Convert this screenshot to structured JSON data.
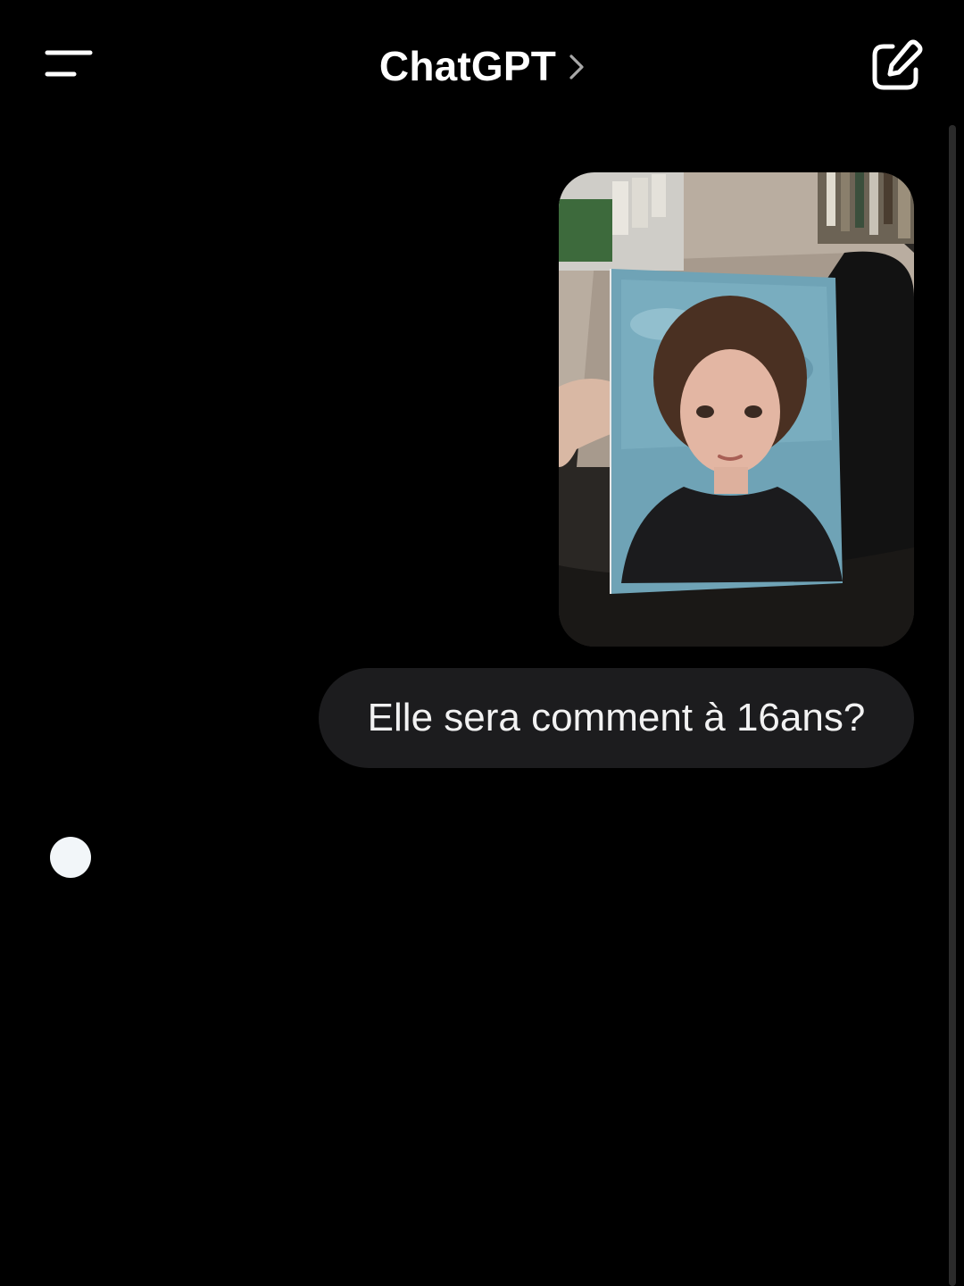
{
  "header": {
    "title": "ChatGPT",
    "menu_icon": "menu-icon",
    "title_chevron_icon": "chevron-right-icon",
    "new_chat_icon": "new-chat-icon"
  },
  "conversation": {
    "user_message": {
      "attachment": "photo",
      "text": "Elle sera comment à 16ans?"
    },
    "assistant": {
      "state": "thinking",
      "indicator_icon": "typing-indicator-icon"
    }
  },
  "colors": {
    "background": "#000000",
    "bubble": "#1c1c1e",
    "text": "#ffffff",
    "indicator": "#f2f6f9"
  }
}
